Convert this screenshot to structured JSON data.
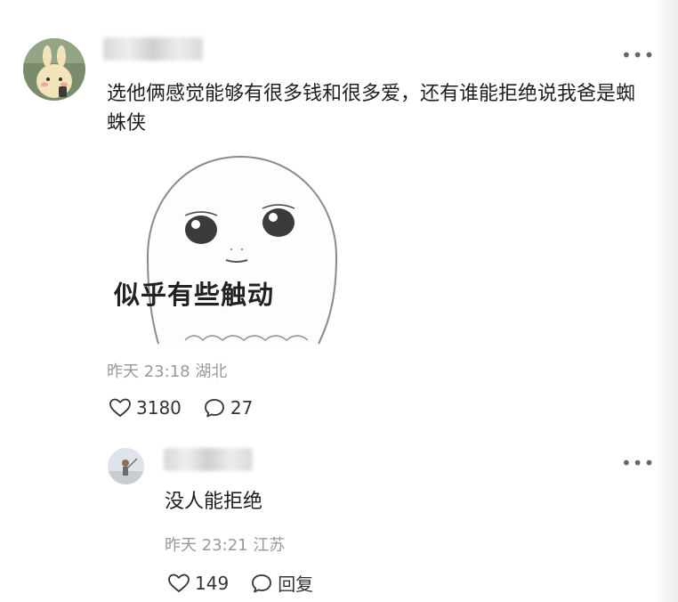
{
  "comments": [
    {
      "text": "选他俩感觉能够有很多钱和很多爱，还有谁能拒绝说我爸是蜘蛛侠",
      "sticker_caption": "似乎有些触动",
      "time": "昨天 23:18",
      "location": "湖北",
      "likes": "3180",
      "replies": "27"
    }
  ],
  "reply": {
    "text": "没人能拒绝",
    "time": "昨天 23:21",
    "location": "江苏",
    "likes": "149",
    "reply_label": "回复"
  },
  "icons": {
    "more": "more-dots-icon",
    "like": "heart-outline-icon",
    "comment": "speech-bubble-icon"
  }
}
